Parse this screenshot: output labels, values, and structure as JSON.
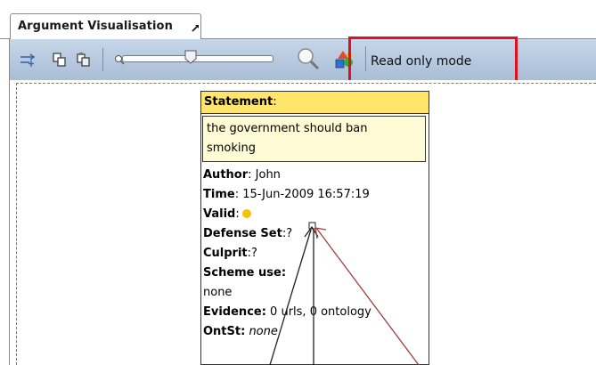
{
  "tab": {
    "title": "Argument Visualisation"
  },
  "toolbar": {
    "mode_label": "Read only mode"
  },
  "node": {
    "header_label": "Statement",
    "header_suffix": ":",
    "statement_line1": "the government should ban",
    "statement_line2": "smoking",
    "author_label": "Author",
    "author_value": ": John",
    "time_label": "Time",
    "time_value": ": 15-Jun-2009 16:57:19",
    "valid_label": "Valid",
    "valid_value": ":",
    "defense_label": "Defense Set",
    "defense_value": ":?",
    "culprit_label": "Culprit",
    "culprit_value": ":?",
    "scheme_label": "Scheme use:",
    "scheme_value": "none",
    "evidence_label": "Evidence:",
    "evidence_value": " 0 urls, 0 ontology",
    "ontst_label": "OntSt:",
    "ontst_value": "none"
  },
  "colors": {
    "highlight": "#e0101f",
    "header_bg": "#ffe56a",
    "statement_bg": "#fffbd6",
    "toolbar_bg": "#b6c8de",
    "arrow_dark": "#222222",
    "arrow_red": "#a33b3b"
  },
  "icons": [
    "add-link-icon",
    "copy-icon",
    "paste-icon",
    "zoom-out-icon",
    "zoom-slider",
    "zoom-in-icon",
    "shapes-icon",
    "pin-icon",
    "valid-smiley-icon"
  ]
}
